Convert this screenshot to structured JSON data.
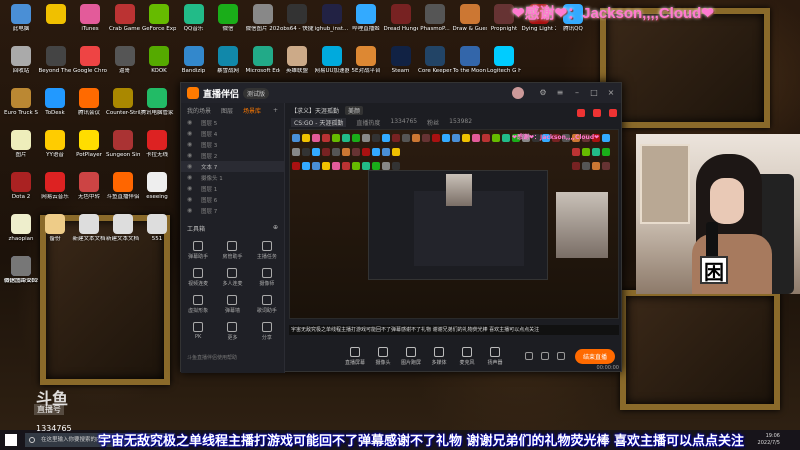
{
  "banner": "❤感谢❤：Jackson,,,,Cloud❤",
  "desktop_icons": [
    {
      "label": "此电脑",
      "color": "#4a8fd6"
    },
    {
      "label": "",
      "color": "#f0c000"
    },
    {
      "label": "iTunes",
      "color": "#e35b9a"
    },
    {
      "label": "Crab Game",
      "color": "#b33"
    },
    {
      "label": "GeForce Experience",
      "color": "#6b0"
    },
    {
      "label": "QQ音乐",
      "color": "#2b8"
    },
    {
      "label": "微信",
      "color": "#1aad19"
    },
    {
      "label": "微信图片 2021111...",
      "color": "#888"
    },
    {
      "label": "obs64 - 快捷方式",
      "color": "#333"
    },
    {
      "label": "ighub_inst...",
      "color": "#224"
    },
    {
      "label": "哔哩直播姬",
      "color": "#3af"
    },
    {
      "label": "Dread Hunger",
      "color": "#722"
    },
    {
      "label": "PhasmoP...",
      "color": "#555"
    },
    {
      "label": "Draw & Guess",
      "color": "#c73"
    },
    {
      "label": "Propnight",
      "color": "#633"
    },
    {
      "label": "Dying Light 2",
      "color": "#a11"
    },
    {
      "label": "腾讯QQ",
      "color": "#3af"
    },
    {
      "label": "回收站",
      "color": "#aaa"
    },
    {
      "label": "Beyond The Wire Sour...",
      "color": "#444"
    },
    {
      "label": "Google Chrome",
      "color": "#e44"
    },
    {
      "label": "逼哥",
      "color": "#555"
    },
    {
      "label": "KOOK",
      "color": "#5a0"
    },
    {
      "label": "Bandizip",
      "color": "#38c"
    },
    {
      "label": "暴雪战网",
      "color": "#18a"
    },
    {
      "label": "Microsoft Edge",
      "color": "#2a8"
    },
    {
      "label": "英雄联盟",
      "color": "#ca8"
    },
    {
      "label": "网易UU加速器",
      "color": "#0ad"
    },
    {
      "label": "5E对战平台",
      "color": "#d83"
    },
    {
      "label": "Steam",
      "color": "#124"
    },
    {
      "label": "Core Keeper...",
      "color": "#246"
    },
    {
      "label": "To the Moon",
      "color": "#36a"
    },
    {
      "label": "Logitech G HUB",
      "color": "#0cf"
    },
    {
      "label": "Euro Truck Simulator 2",
      "color": "#b83"
    },
    {
      "label": "ToDesk",
      "color": "#29f"
    },
    {
      "label": "腾讯会议",
      "color": "#ff6a00"
    },
    {
      "label": "Counter-Strike Global Off...",
      "color": "#a80"
    },
    {
      "label": "腾讯电脑管家",
      "color": "#2b6"
    },
    {
      "label": "图片",
      "color": "#eeb"
    },
    {
      "label": "YY语音",
      "color": "#fc0"
    },
    {
      "label": "PotPlayer",
      "color": "#fd0"
    },
    {
      "label": "Sungeon Simulator 2",
      "color": "#a33"
    },
    {
      "label": "卡拉无线",
      "color": "#d22"
    },
    {
      "label": "Dota 2",
      "color": "#a22"
    },
    {
      "label": "网易云音乐",
      "color": "#d22"
    },
    {
      "label": "无色中转",
      "color": "#c44"
    },
    {
      "label": "斗鱼直播伴侣",
      "color": "#f60"
    },
    {
      "label": "eseeing",
      "color": "#eee"
    },
    {
      "label": "zhaopian",
      "color": "#eec"
    },
    {
      "label": "备份",
      "color": "#ec8"
    },
    {
      "label": "新建文本文档",
      "color": "#ddd"
    },
    {
      "label": "新建文本文档 (2)",
      "color": "#ddd"
    },
    {
      "label": "551",
      "color": "#ddd"
    },
    {
      "label": "新建文本文档 (3)",
      "color": "#ddd"
    },
    {
      "label": "BOCBank...",
      "color": "#46c"
    },
    {
      "label": "微信图片 202201...",
      "color": "#777"
    }
  ],
  "app": {
    "name": "直播伴侣",
    "version": "测试版",
    "left_tabs": [
      "我的场景",
      "图层",
      "场景库"
    ],
    "layers": [
      "图层 5",
      "图层 4",
      "图层 3",
      "图层 2",
      "文本 7",
      "摄像头 1",
      "图层 1",
      "图层 6",
      "图层 7"
    ],
    "tools_title": "工具箱",
    "tools": [
      "弹幕助手",
      "房管助手",
      "主播任务",
      "视频连麦",
      "多人连麦",
      "摄像师",
      "虚拟形象",
      "弹幕墙",
      "歌词助手",
      "PK",
      "更多",
      "分享"
    ],
    "room": {
      "category_tag": "【求义】天涯孤勤",
      "extra_tag": "美颜",
      "game": "CS:GO - 天涯孤勤",
      "heat_label": "直播热度",
      "heat": "1334765",
      "fans_label": "粉丝",
      "fans": "153982"
    },
    "preview_banner": "❤感谢❤：Jackson,,,,Cloud❤",
    "scroll_text": "宇宙无敌究极之单线程主播打游戏可能回不了弹幕感谢不了礼物 谢谢兄弟们的礼物荧光棒 喜欢主播可以点点关注",
    "bottom_buttons": [
      "直播屏幕",
      "摄像头",
      "图片跑屏",
      "多媒体",
      "麦克风",
      "扬声器"
    ],
    "live_button": "结束直播",
    "timer": "00:00:00",
    "footer": "斗鱼直播伴侣使用帮助"
  },
  "webcam_sign": "困",
  "douyu_logo": "斗鱼",
  "douyu_sub": "直播号",
  "room_number": "1334765",
  "marquee": "宇宙无敌究极之单线程主播打游戏可能回不了弹幕感谢不了礼物 谢谢兄弟们的礼物荧光棒 喜欢主播可以点点关注",
  "taskbar": {
    "search_placeholder": "在这里输入你要搜索的内容",
    "time": "19:06",
    "date": "2022/7/5"
  }
}
